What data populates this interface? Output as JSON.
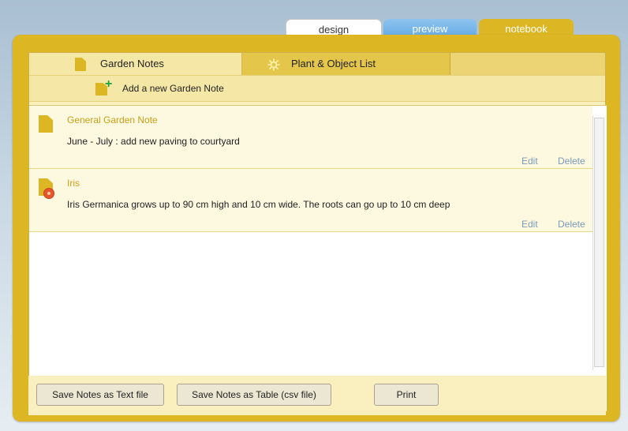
{
  "top_tabs": {
    "design": "design",
    "preview": "preview",
    "notebook": "notebook"
  },
  "sub_tabs": {
    "notes": "Garden Notes",
    "plants": "Plant & Object List"
  },
  "add_note_label": "Add a new Garden Note",
  "notes": [
    {
      "title": "General Garden Note",
      "body": "June - July : add new paving to courtyard",
      "edit": "Edit",
      "delete": "Delete"
    },
    {
      "title": "Iris",
      "body": "Iris Germanica grows up to 90 cm high and 10 cm wide. The roots can go up to 10 cm deep",
      "edit": "Edit",
      "delete": "Delete"
    }
  ],
  "buttons": {
    "save_text": "Save Notes as Text file",
    "save_csv": "Save Notes as Table (csv file)",
    "print": "Print"
  },
  "colors": {
    "frame": "#dcb623",
    "panel": "#faf0bf",
    "accent_text": "#c8a019",
    "link": "#7a9bb8",
    "preview_tab": "#5ea7e2"
  },
  "icons": {
    "note": "note-document-icon",
    "plant": "sun-icon",
    "add": "add-note-icon",
    "plant_badge": "flower-badge-icon"
  }
}
